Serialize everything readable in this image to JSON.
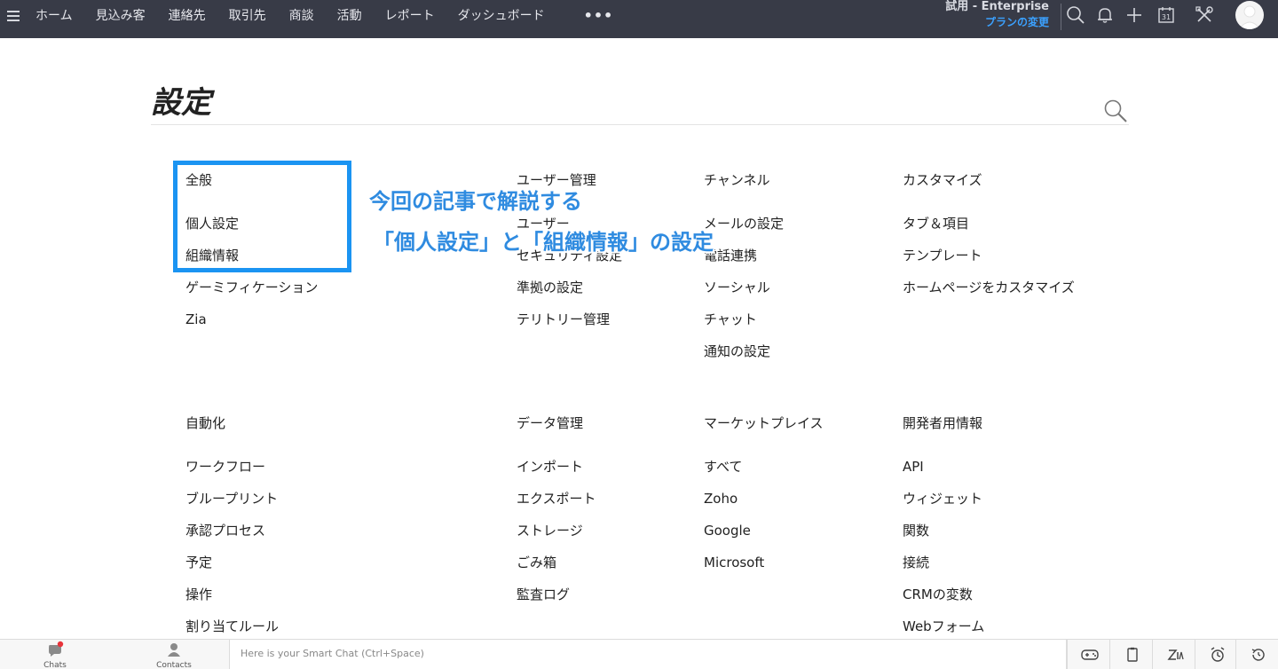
{
  "nav": {
    "items": [
      "ホーム",
      "見込み客",
      "連絡先",
      "取引先",
      "商談",
      "活動",
      "レポート",
      "ダッシュボード"
    ],
    "more": "•••"
  },
  "trial": {
    "label": "試用 - Enterprise",
    "link": "プランの変更"
  },
  "icons": {
    "calendar_day": "31"
  },
  "page": {
    "title": "設定"
  },
  "columns": [
    {
      "sections": [
        {
          "heading": "全般",
          "items": [
            "個人設定",
            "組織情報",
            "ゲーミフィケーション",
            "Zia"
          ]
        },
        {
          "heading": "自動化",
          "items": [
            "ワークフロー",
            "ブループリント",
            "承認プロセス",
            "予定",
            "操作",
            "割り当てルール"
          ]
        }
      ]
    },
    {
      "sections": [
        {
          "heading": "ユーザー管理",
          "items": [
            "ユーザー",
            "セキュリティ設定",
            "準拠の設定",
            "テリトリー管理"
          ]
        },
        {
          "heading": "データ管理",
          "items": [
            "インポート",
            "エクスポート",
            "ストレージ",
            "ごみ箱",
            "監査ログ"
          ]
        }
      ]
    },
    {
      "sections": [
        {
          "heading": "チャンネル",
          "items": [
            "メールの設定",
            "電話連携",
            "ソーシャル",
            "チャット",
            "通知の設定"
          ]
        },
        {
          "heading": "マーケットプレイス",
          "items": [
            "すべて",
            "Zoho",
            "Google",
            "Microsoft"
          ]
        }
      ]
    },
    {
      "sections": [
        {
          "heading": "カスタマイズ",
          "items": [
            "タブ＆項目",
            "テンプレート",
            "ホームページをカスタマイズ"
          ]
        },
        {
          "heading": "開発者用情報",
          "items": [
            "API",
            "ウィジェット",
            "関数",
            "接続",
            "CRMの変数",
            "Webフォーム"
          ]
        }
      ]
    }
  ],
  "annotation": {
    "line1": "今回の記事で解説する",
    "line2": "「個人設定」と「組織情報」の設定"
  },
  "bottom": {
    "chats": "Chats",
    "contacts": "Contacts",
    "smart_chat_placeholder": "Here is your Smart Chat (Ctrl+Space)"
  },
  "colors": {
    "topbar": "#383b47",
    "accent": "#3ba1ff",
    "highlight": "#1b94f2",
    "notify": "#e8333a"
  }
}
